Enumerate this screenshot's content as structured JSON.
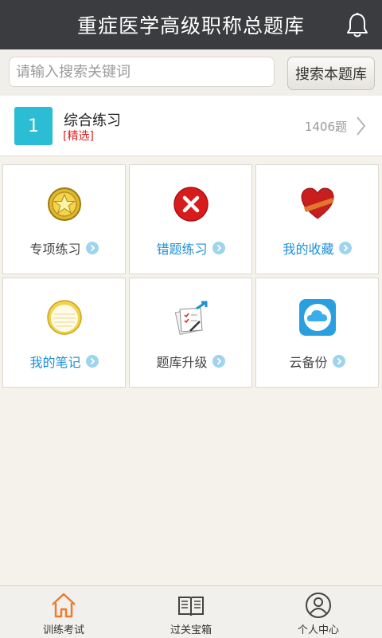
{
  "header": {
    "title": "重症医学高级职称总题库",
    "icon": "bell-icon"
  },
  "search": {
    "placeholder": "请输入搜索关键词",
    "value": "",
    "button_label": "搜索本题库"
  },
  "featured": {
    "badge": "1",
    "title": "综合练习",
    "tag": "[精选]",
    "count": "1406题"
  },
  "tiles": [
    {
      "label": "专项练习",
      "icon": "star-medal-icon",
      "highlight": false
    },
    {
      "label": "错题练习",
      "icon": "red-x-icon",
      "highlight": true
    },
    {
      "label": "我的收藏",
      "icon": "heart-icon",
      "highlight": true
    },
    {
      "label": "我的笔记",
      "icon": "notepad-icon",
      "highlight": true
    },
    {
      "label": "题库升级",
      "icon": "document-arrow-icon",
      "highlight": false
    },
    {
      "label": "云备份",
      "icon": "cloud-icon",
      "highlight": false
    }
  ],
  "tabs": [
    {
      "label": "训练考试",
      "icon": "home-icon",
      "active": true
    },
    {
      "label": "过关宝箱",
      "icon": "book-icon",
      "active": false
    },
    {
      "label": "个人中心",
      "icon": "user-icon",
      "active": false
    }
  ],
  "colors": {
    "header_bg": "#3b3c3f",
    "accent_cyan": "#2bbdd4",
    "link_blue": "#1f8fd6",
    "tag_red": "#e02323",
    "active_tab": "#ef7b2a"
  }
}
